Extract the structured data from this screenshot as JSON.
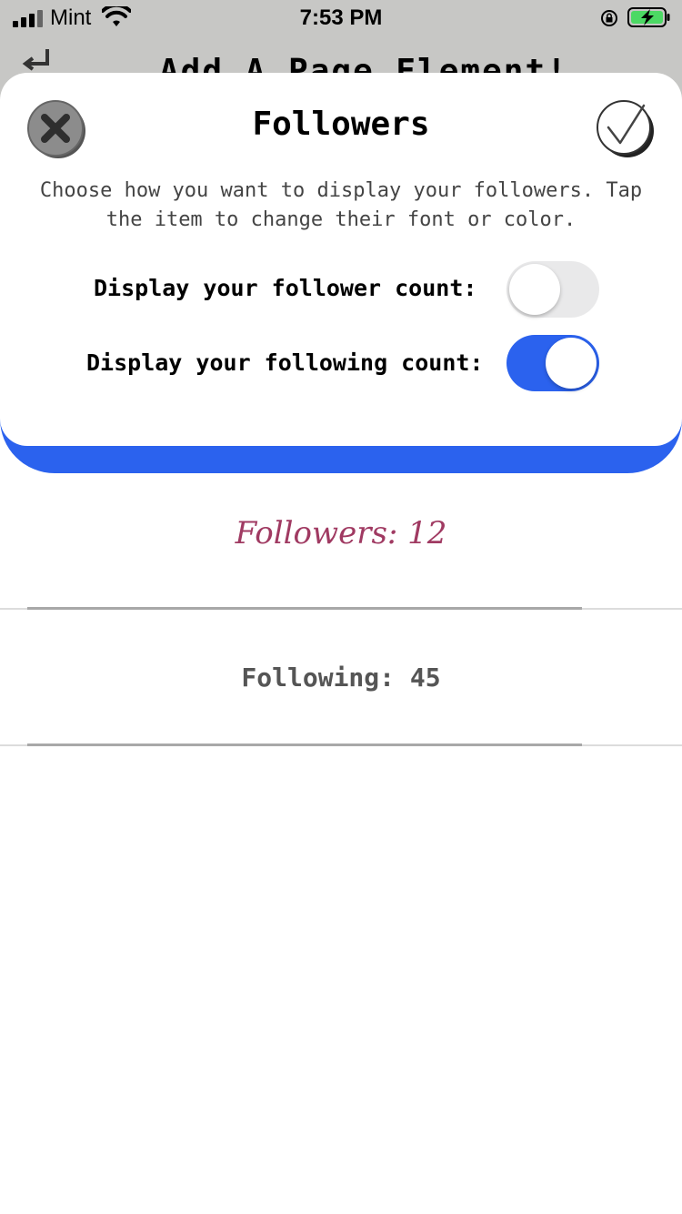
{
  "status_bar": {
    "carrier": "Mint",
    "time": "7:53 PM"
  },
  "background": {
    "title": "Add A Page Element!"
  },
  "sheet": {
    "title": "Followers",
    "description": "Choose how you want to display your followers. Tap the item to change their font or color.",
    "options": [
      {
        "label": "Display your follower count:",
        "enabled": false
      },
      {
        "label": "Display your following count:",
        "enabled": true
      }
    ]
  },
  "preview": {
    "followers": "Followers: 12",
    "following": "Following: 45"
  },
  "colors": {
    "accent_blue": "#2b62ee",
    "followers_text": "#a03a62",
    "top_background": "#c7c7c5"
  }
}
